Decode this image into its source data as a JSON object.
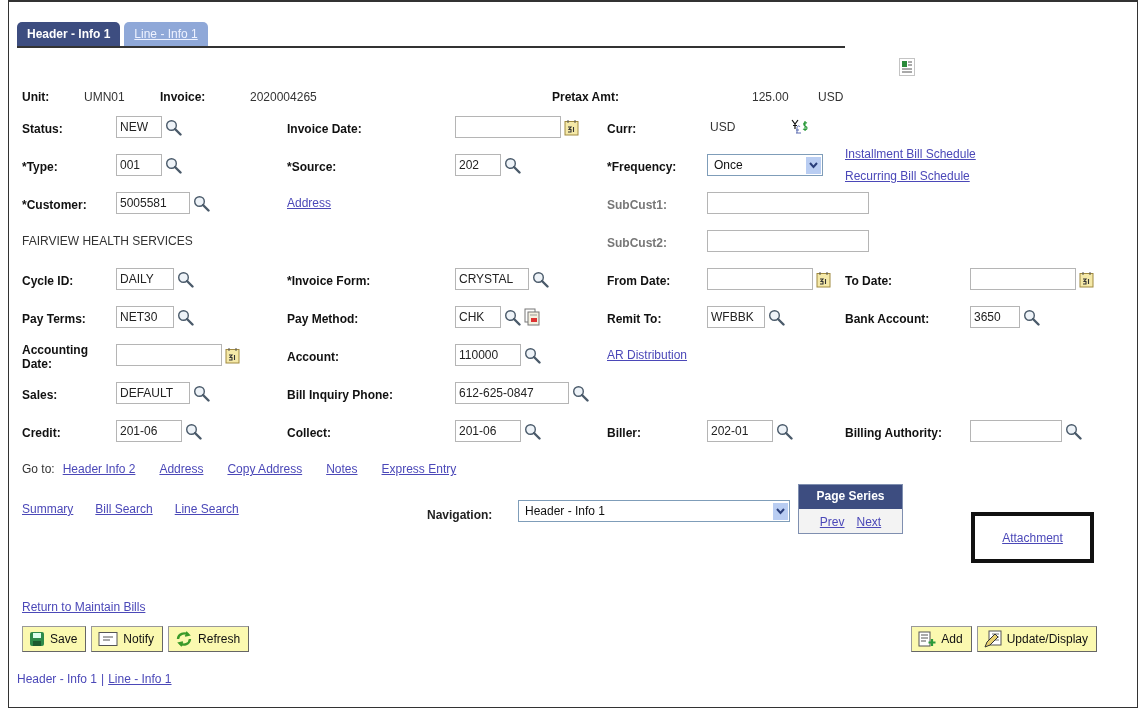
{
  "tabs": [
    {
      "label": "Header - Info 1",
      "selected": true
    },
    {
      "label": "Line - Info 1",
      "selected": false
    }
  ],
  "summary": {
    "items": [
      {
        "label": "Unit:",
        "value": "UMN01"
      },
      {
        "label": "Invoice:",
        "value": "2020004265"
      }
    ],
    "pretax": {
      "label": "Pretax Amt:",
      "amount": "125.00",
      "currency": "USD"
    }
  },
  "rows": [
    [
      {
        "label": "Status:",
        "disabled": false,
        "kind": "lookup",
        "value": "NEW"
      },
      {
        "label": "Invoice Date:",
        "disabled": false,
        "kind": "date"
      },
      {
        "label": "Curr:",
        "disabled": false,
        "kind": "currency",
        "value": "USD"
      }
    ],
    [
      {
        "label": "*Type:",
        "disabled": false,
        "kind": "lookup",
        "value": "001"
      },
      {
        "label": "*Source:",
        "disabled": false,
        "kind": "lookup",
        "value": "202"
      },
      {
        "label": "*Frequency:",
        "disabled": false,
        "kind": "select",
        "value": "Once"
      },
      {
        "kind": "links",
        "links": [
          "Installment Bill Schedule",
          "Recurring Bill Schedule"
        ]
      }
    ],
    [
      {
        "label": "*Customer:",
        "disabled": false,
        "kind": "lookup",
        "value": "5005581"
      },
      {
        "kind": "link",
        "value": "Address"
      },
      {
        "label": "SubCust1:",
        "disabled": true,
        "kind": "input"
      }
    ],
    [
      {
        "kind": "text",
        "value": "FAIRVIEW HEALTH SERVICES"
      },
      {
        "kind": "blank"
      },
      {
        "label": "SubCust2:",
        "disabled": true,
        "kind": "input"
      }
    ],
    [
      {
        "label": "Cycle ID:",
        "disabled": false,
        "kind": "lookup",
        "value": "DAILY"
      },
      {
        "label": "*Invoice Form:",
        "disabled": false,
        "kind": "lookup",
        "value": "CRYSTAL"
      },
      {
        "label": "From Date:",
        "disabled": false,
        "kind": "date"
      },
      {
        "label": "To Date:",
        "disabled": false,
        "kind": "date"
      }
    ],
    [
      {
        "label": "Pay Terms:",
        "disabled": false,
        "kind": "lookup",
        "value": "NET30"
      },
      {
        "label": "Pay Method:",
        "disabled": false,
        "kind": "lookup_doc",
        "value": "CHK"
      },
      {
        "label": "Remit To:",
        "disabled": false,
        "kind": "lookup",
        "value": "WFBBK"
      },
      {
        "label": "Bank Account:",
        "disabled": false,
        "kind": "lookup",
        "value": "3650"
      }
    ],
    [
      {
        "label": "Accounting Date:",
        "disabled": false,
        "kind": "date"
      },
      {
        "label": "Account:",
        "disabled": false,
        "kind": "lookup",
        "value": "110000"
      },
      {
        "kind": "link",
        "value": "AR Distribution"
      }
    ],
    [
      {
        "label": "Sales:",
        "disabled": false,
        "kind": "lookup",
        "value": "DEFAULT"
      },
      {
        "label": "Bill Inquiry Phone:",
        "disabled": false,
        "kind": "lookup",
        "value": "612-625-0847"
      }
    ],
    [
      {
        "label": "Credit:",
        "disabled": false,
        "kind": "lookup",
        "value": "201-06"
      },
      {
        "label": "Collect:",
        "disabled": false,
        "kind": "lookup",
        "value": "201-06"
      },
      {
        "label": "Biller:",
        "disabled": false,
        "kind": "lookup",
        "value": "202-01"
      },
      {
        "label": "Billing Authority:",
        "disabled": false,
        "kind": "lookup"
      }
    ]
  ],
  "goto": {
    "label": "Go to:",
    "links": [
      "Header Info 2",
      "Address",
      "Copy Address",
      "Notes",
      "Express Entry"
    ]
  },
  "quick_links": [
    "Summary",
    "Bill Search",
    "Line Search"
  ],
  "navigation": {
    "label": "Navigation:",
    "value": "Header - Info 1"
  },
  "page_series": {
    "title": "Page Series",
    "links": [
      "Prev",
      "Next"
    ]
  },
  "attachment": "Attachment",
  "return_link": "Return to Maintain Bills",
  "left_buttons": [
    {
      "kind": "save",
      "label": "Save"
    },
    {
      "kind": "notify",
      "label": "Notify"
    },
    {
      "kind": "refresh",
      "label": "Refresh"
    }
  ],
  "right_buttons": [
    {
      "kind": "add",
      "label": "Add"
    },
    {
      "kind": "update",
      "label": "Update/Display"
    }
  ],
  "footer": {
    "separator": "|",
    "items": [
      {
        "label": "Header - Info 1",
        "selected": true
      },
      {
        "label": "Line - Info 1",
        "selected": false
      }
    ]
  }
}
